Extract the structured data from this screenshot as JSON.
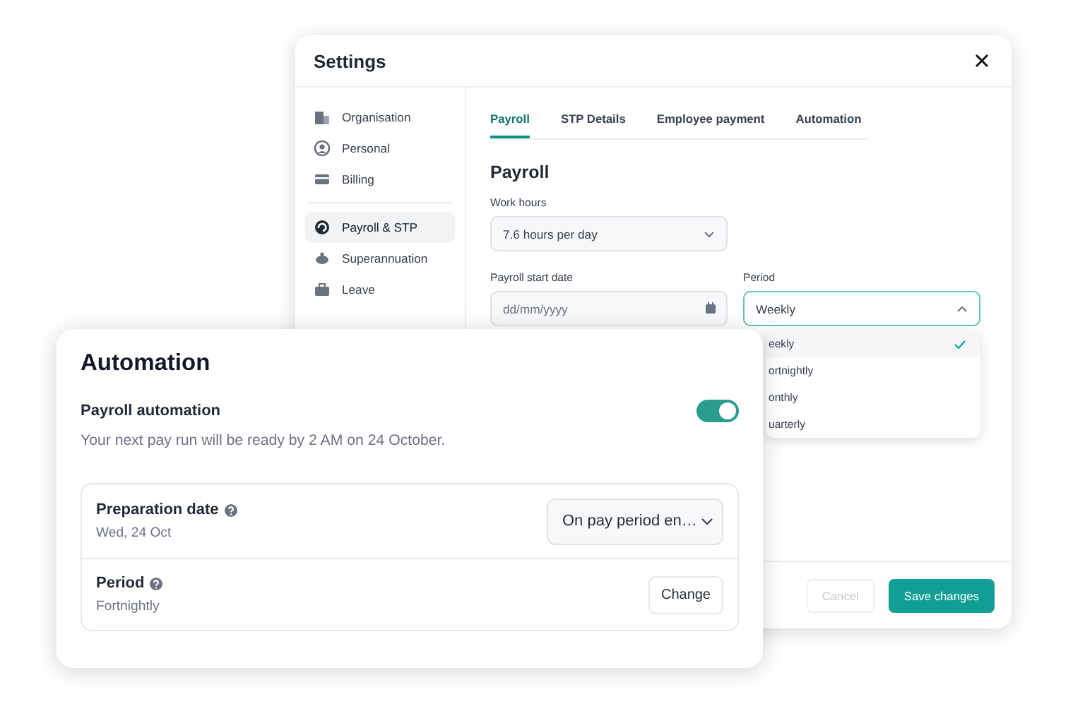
{
  "settings": {
    "title": "Settings",
    "sidebar": {
      "groups": [
        [
          {
            "label": "Organisation",
            "selected": false
          },
          {
            "label": "Personal",
            "selected": false
          },
          {
            "label": "Billing",
            "selected": false
          }
        ],
        [
          {
            "label": "Payroll & STP",
            "selected": true
          },
          {
            "label": "Superannuation",
            "selected": false
          },
          {
            "label": "Leave",
            "selected": false
          }
        ]
      ]
    },
    "tabs": [
      {
        "label": "Payroll",
        "selected": true
      },
      {
        "label": "STP Details",
        "selected": false
      },
      {
        "label": "Employee payment",
        "selected": false
      },
      {
        "label": "Automation",
        "selected": false
      }
    ],
    "section_title": "Payroll",
    "work_hours": {
      "label": "Work hours",
      "value": "7.6 hours per day"
    },
    "payroll_start_date": {
      "label": "Payroll start date",
      "placeholder": "dd/mm/yyyy"
    },
    "period": {
      "label": "Period",
      "value": "Weekly",
      "expanded": true,
      "options": [
        {
          "label": "eekly",
          "selected": true
        },
        {
          "label": "ortnightly",
          "selected": false
        },
        {
          "label": "onthly",
          "selected": false
        },
        {
          "label": "uarterly",
          "selected": false
        }
      ]
    },
    "buttons": [
      {
        "label": "Cancel",
        "kind": "secondary",
        "disabled": true
      },
      {
        "label": "Save changes",
        "kind": "primary",
        "disabled": false
      }
    ]
  },
  "automation": {
    "title": "Automation",
    "toggle": {
      "label": "Payroll automation",
      "description": "Your next pay run will be ready by 2 AM on 24 October.",
      "on": true
    },
    "rows": [
      {
        "label": "Preparation date",
        "value": "Wed, 24 Oct",
        "kind": "select",
        "control": "On pay period en…"
      },
      {
        "label": "Period",
        "value": "Fortnightly",
        "kind": "button",
        "control": "Change"
      }
    ]
  }
}
